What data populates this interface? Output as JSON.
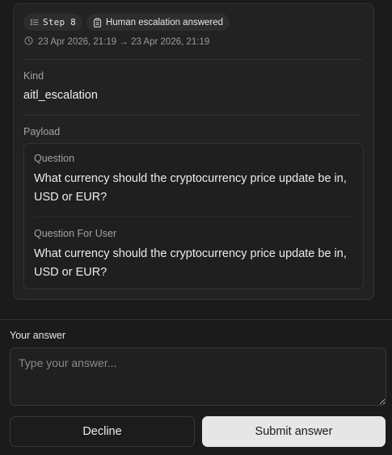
{
  "step": {
    "label": "Step 8",
    "status": "Human escalation answered",
    "time_range": "23 Apr 2026, 21:19 → 23 Apr 2026, 21:19"
  },
  "kind": {
    "label": "Kind",
    "value": "aitl_escalation"
  },
  "payload": {
    "label": "Payload",
    "question": {
      "label": "Question",
      "value": "What currency should the cryptocurrency price update be in, USD or EUR?"
    },
    "question_for_user": {
      "label": "Question For User",
      "value": "What currency should the cryptocurrency price update be in, USD or EUR?"
    }
  },
  "answer": {
    "label": "Your answer",
    "placeholder": "Type your answer...",
    "value": ""
  },
  "buttons": {
    "decline": "Decline",
    "submit": "Submit answer"
  },
  "icons": {
    "step": "list-steps-icon",
    "status": "clipboard-icon",
    "time": "clock-icon"
  }
}
